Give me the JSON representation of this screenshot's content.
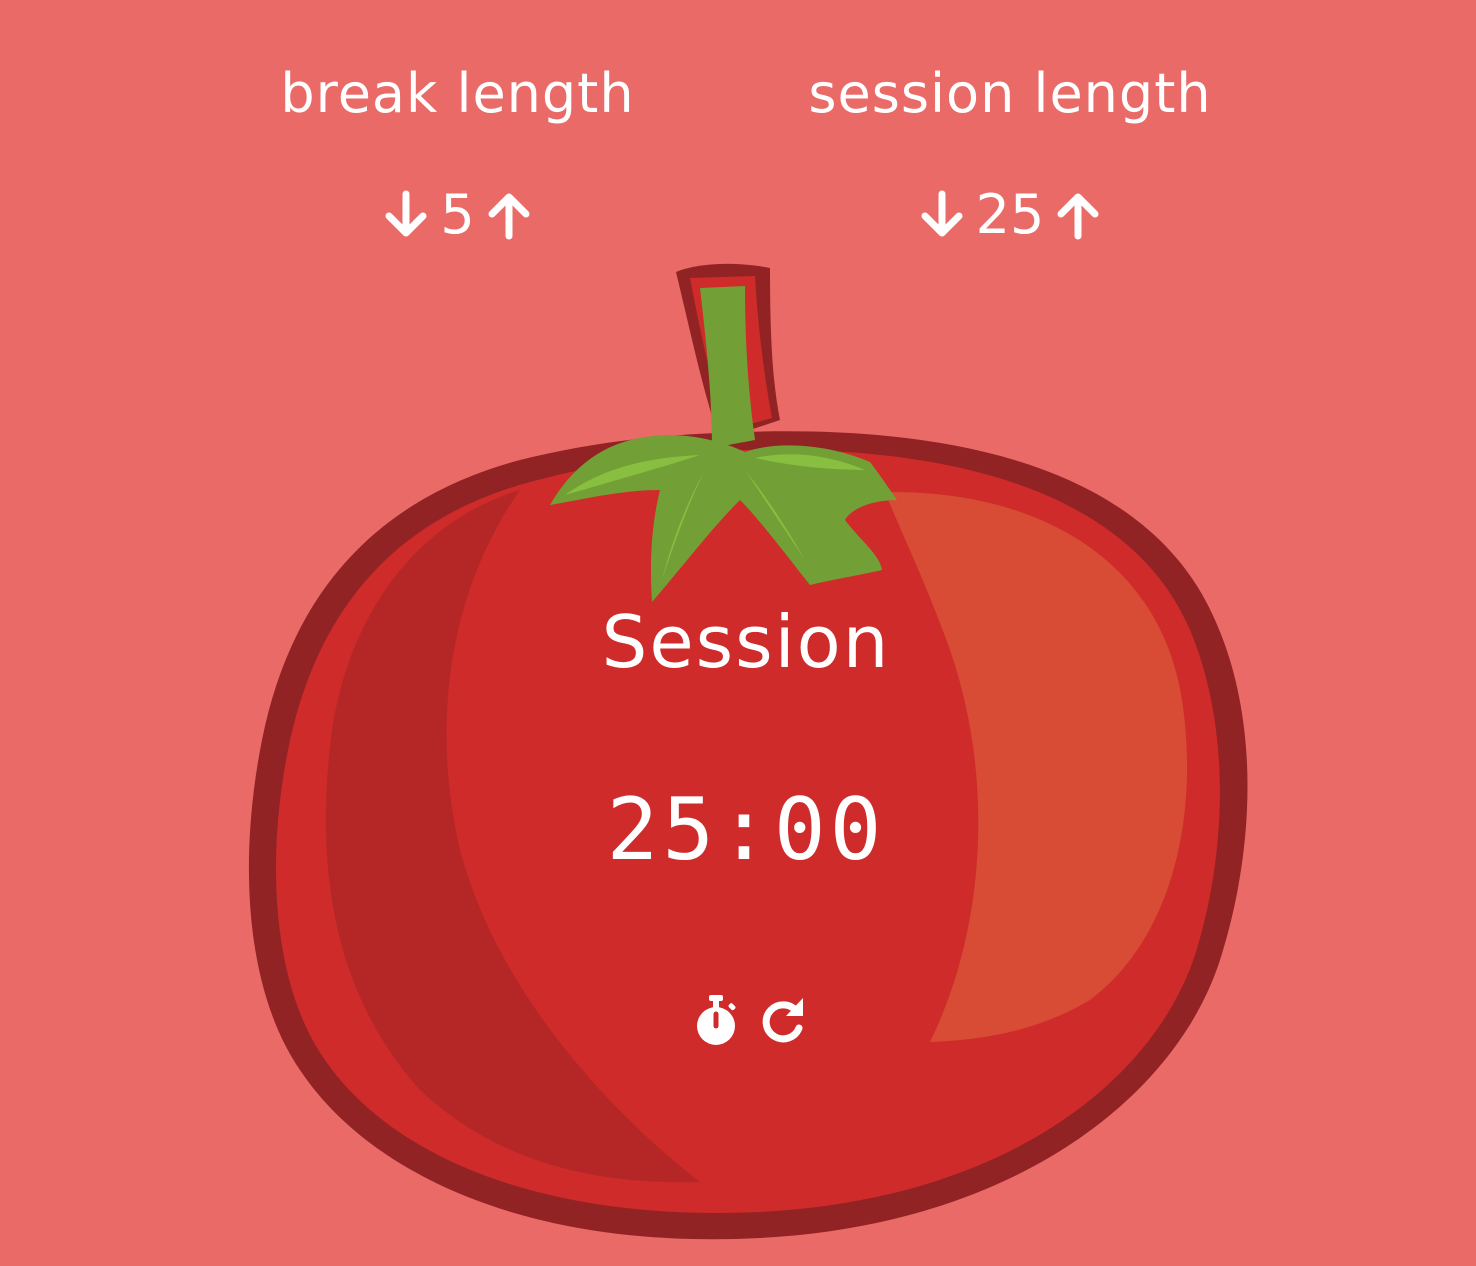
{
  "colors": {
    "background": "#E96A66",
    "tomato_body": "#CE2B2A",
    "tomato_outline": "#912324",
    "tomato_shadow": "#B52726",
    "tomato_highlight": "#D84C35",
    "stem_green": "#729F36",
    "leaf_light": "#88BF40",
    "text": "#FFFFFF"
  },
  "break": {
    "label": "break length",
    "value": "5",
    "decrement_icon": "arrow-down-icon",
    "increment_icon": "arrow-up-icon"
  },
  "session": {
    "label": "session length",
    "value": "25",
    "decrement_icon": "arrow-down-icon",
    "increment_icon": "arrow-up-icon"
  },
  "timer": {
    "label": "Session",
    "time_left": "25:00",
    "start_stop_icon": "stopwatch-icon",
    "reset_icon": "redo-icon"
  }
}
